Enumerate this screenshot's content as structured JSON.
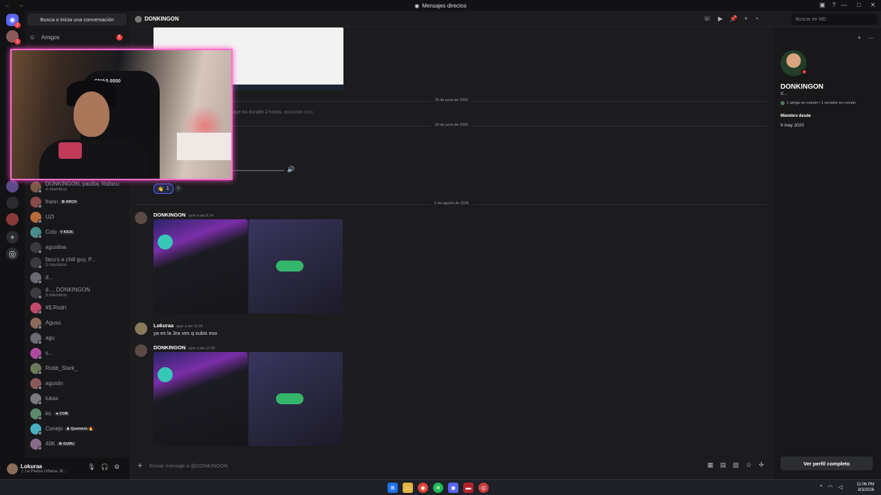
{
  "window": {
    "title": "Mensajes directos",
    "nav_arrows": "← →",
    "controls": [
      "—",
      "□",
      "✕"
    ],
    "extra_icons": [
      "inbox-icon",
      "help-icon"
    ]
  },
  "sidebar": {
    "search_label": "Busca o inicia una conversación",
    "friends_label": "Amigos",
    "friends_badge": "1",
    "dms": [
      {
        "name": "DONKINGON, paulita, Rafacu",
        "sub": "4 miembros",
        "color": "#7a5a46"
      },
      {
        "name": "frann",
        "tag": "⚙ ARCH",
        "sub": "",
        "color": "#8c4a4a"
      },
      {
        "name": "UZI",
        "sub": "",
        "color": "#b56a3a"
      },
      {
        "name": "Colo",
        "tag": "Y KICK",
        "sub": "",
        "color": "#4a8c8c"
      },
      {
        "name": "agustina",
        "sub": "",
        "color": "#3a3a40"
      },
      {
        "name": "facu's a chill guy, P...",
        "sub": "3 miembros",
        "color": "#3a3a40"
      },
      {
        "name": "d...",
        "sub": "",
        "color": "#6a6a72"
      },
      {
        "name": "d..., DONKINGON",
        "sub": "3 miembros",
        "color": "#3a3a40"
      },
      {
        "name": "¥$.Rodri",
        "sub": "",
        "color": "#c24a6a"
      },
      {
        "name": "Aguss.",
        "sub": "",
        "color": "#8a6a5a"
      },
      {
        "name": "agu",
        "sub": "",
        "color": "#6a6a72"
      },
      {
        "name": "s...",
        "sub": "",
        "color": "#b04aa0"
      },
      {
        "name": "Robb_Stark_",
        "sub": "",
        "color": "#6a7a5a"
      },
      {
        "name": "agustin",
        "sub": "",
        "color": "#8a5a5a"
      },
      {
        "name": "lukas",
        "sub": "",
        "color": "#7a7a80"
      },
      {
        "name": "ks.",
        "tag": "♣ COB",
        "sub": "",
        "color": "#5a8a6a"
      },
      {
        "name": "Conejo",
        "tag": "♟ Quemero 🔥",
        "sub": "",
        "color": "#4ab0c0"
      },
      {
        "name": "40K",
        "tag": "⚙ GURU",
        "sub": "",
        "color": "#8a6a8a"
      }
    ]
  },
  "user_panel": {
    "name": "Lokuraa",
    "status": "♫ La Piedra Urbana, M..."
  },
  "channel": {
    "name": "DONKINGON",
    "search_placeholder": "Buscar en MD"
  },
  "messages": {
    "faded_text_1": "que ha durado 2 horas.",
    "faded_time_1": "25/06/2026 23:11",
    "divider_1": "25 de junio de 2026",
    "divider_2": "29 de junio de 2026",
    "divider_3": "2 de agosto de 2026",
    "reaction_emoji": "👋",
    "reaction_count": "1",
    "msg1_author": "DONKINGON",
    "msg1_time": "ayer a las 8:14",
    "msg2_author": "Lokuraa",
    "msg2_time": "ayer a las 11:00",
    "msg2_text": "ya es la 3ra ves q subis eso",
    "msg3_author": "DONKINGON",
    "msg3_time": "ayer a las 11:40"
  },
  "composer": {
    "placeholder": "Enviar mensaje a @DONKINGON"
  },
  "profile": {
    "name": "DONKINGON",
    "desc": "d...",
    "mutual": "1 amigo en común • 1 servidor en común",
    "member_since_label": "Miembro desde",
    "member_since": "9 may 2020",
    "full_profile": "Ver perfil completo"
  },
  "webcam": {
    "chair_label": "CMAS 0000"
  },
  "taskbar": {
    "time": "11:06 PM",
    "date": "8/3/2026"
  },
  "colors": {
    "accent": "#5865f2",
    "danger": "#f23f43",
    "cam_border": "#ff6bd0"
  }
}
